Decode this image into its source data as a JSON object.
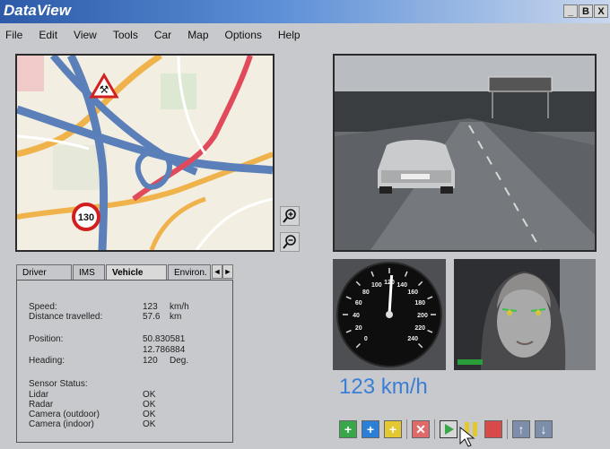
{
  "window": {
    "title": "DataView"
  },
  "menu": [
    "File",
    "Edit",
    "View",
    "Tools",
    "Car",
    "Map",
    "Options",
    "Help"
  ],
  "window_buttons": [
    "_",
    "В",
    "X"
  ],
  "map": {
    "speed_limit_sign": "130"
  },
  "tabs": [
    "Driver",
    "IMS",
    "Vehicle",
    "Environ."
  ],
  "tab_arrows": [
    "◄",
    "►"
  ],
  "info": {
    "speed": {
      "label": "Speed:",
      "value": "123",
      "unit": "km/h"
    },
    "distance": {
      "label": "Distance travelled:",
      "value": "57.6",
      "unit": "km"
    },
    "position": {
      "label": "Position:",
      "lat": "50.830581",
      "lon": "12.786884"
    },
    "heading": {
      "label": "Heading:",
      "value": "120",
      "unit": "Deg."
    },
    "sensor_status": {
      "label": "Sensor Status:"
    },
    "sensors": [
      {
        "name": "Lidar",
        "status": "OK"
      },
      {
        "name": "Radar",
        "status": "OK"
      },
      {
        "name": "Camera (outdoor)",
        "status": "OK"
      },
      {
        "name": "Camera (indoor)",
        "status": "OK"
      }
    ]
  },
  "gauge": {
    "ticks": [
      "0",
      "20",
      "40",
      "60",
      "80",
      "100",
      "120",
      "140",
      "160",
      "180",
      "200",
      "220",
      "240"
    ],
    "value": 123,
    "max": 240
  },
  "speed_readout": "123 km/h",
  "colors": {
    "accent": "#3a7ed6",
    "titlebar": "#2c5aa8"
  }
}
